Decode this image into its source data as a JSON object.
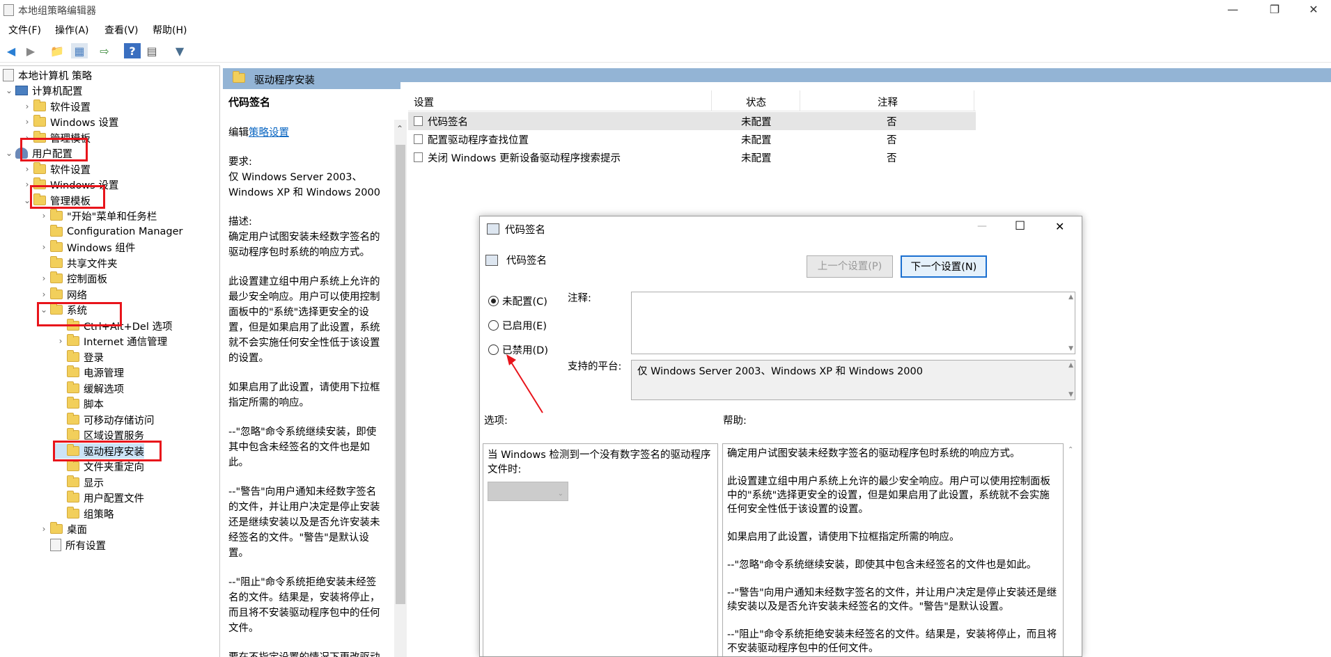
{
  "window": {
    "title": "本地组策略编辑器"
  },
  "menu": [
    "文件(F)",
    "操作(A)",
    "查看(V)",
    "帮助(H)"
  ],
  "tree": {
    "root": "本地计算机 策略",
    "computer_config": "计算机配置",
    "cc_software": "软件设置",
    "cc_windows": "Windows 设置",
    "cc_admin": "管理模板",
    "user_config": "用户配置",
    "uc_software": "软件设置",
    "uc_windows": "Windows 设置",
    "uc_admin": "管理模板",
    "start_menu": "\"开始\"菜单和任务栏",
    "config_manager": "Configuration Manager",
    "windows_components": "Windows 组件",
    "shared_folders": "共享文件夹",
    "control_panel": "控制面板",
    "network": "网络",
    "system": "系统",
    "cad": "Ctrl+Alt+Del 选项",
    "internet_comm": "Internet 通信管理",
    "logon": "登录",
    "power": "电源管理",
    "mitigation": "缓解选项",
    "scripts": "脚本",
    "removable": "可移动存储访问",
    "locale": "区域设置服务",
    "driver_install": "驱动程序安装",
    "folder_redirect": "文件夹重定向",
    "display": "显示",
    "user_profiles": "用户配置文件",
    "group_policy": "组策略",
    "desktop": "桌面",
    "all_settings": "所有设置"
  },
  "right": {
    "header": "驱动程序安装",
    "desc_title": "代码签名",
    "edit_prefix": "编辑",
    "edit_link": "策略设置",
    "requirements_label": "要求:",
    "requirements": "仅 Windows Server 2003、Windows XP 和 Windows 2000",
    "description_label": "描述:",
    "p1": "确定用户试图安装未经数字签名的驱动程序包时系统的响应方式。",
    "p2": "此设置建立组中用户系统上允许的最少安全响应。用户可以使用控制面板中的\"系统\"选择更安全的设置，但是如果启用了此设置，系统就不会实施任何安全性低于该设置的设置。",
    "p3": "如果启用了此设置，请使用下拉框指定所需的响应。",
    "p4": "--\"忽略\"命令系统继续安装，即使其中包含未经签名的文件也是如此。",
    "p5": "--\"警告\"向用户通知未经数字签名的文件，并让用户决定是停止安装还是继续安装以及是否允许安装未经签名的文件。\"警告\"是默认设置。",
    "p6": "--\"阻止\"命令系统拒绝安装未经签名的文件。结果是，安装将停止，而且将不安装驱动程序包中的任何文件。",
    "p7": "要在不指定设置的情况下更改驱动"
  },
  "list": {
    "col_setting": "设置",
    "col_state": "状态",
    "col_comment": "注释",
    "rows": [
      {
        "name": "代码签名",
        "state": "未配置",
        "comment": "否"
      },
      {
        "name": "配置驱动程序查找位置",
        "state": "未配置",
        "comment": "否"
      },
      {
        "name": "关闭 Windows 更新设备驱动程序搜索提示",
        "state": "未配置",
        "comment": "否"
      }
    ]
  },
  "dialog": {
    "title": "代码签名",
    "subtitle": "代码签名",
    "prev_btn": "上一个设置(P)",
    "next_btn": "下一个设置(N)",
    "opt_not_configured": "未配置(C)",
    "opt_enabled": "已启用(E)",
    "opt_disabled": "已禁用(D)",
    "comment_label": "注释:",
    "platform_label": "支持的平台:",
    "platform_value": "仅 Windows Server 2003、Windows XP 和 Windows 2000",
    "options_label": "选项:",
    "help_label": "帮助:",
    "options_text": "当 Windows 检测到一个没有数字签名的驱动程序文件时:",
    "help_p1": "确定用户试图安装未经数字签名的驱动程序包时系统的响应方式。",
    "help_p2": "此设置建立组中用户系统上允许的最少安全响应。用户可以使用控制面板中的\"系统\"选择更安全的设置，但是如果启用了此设置，系统就不会实施任何安全性低于该设置的设置。",
    "help_p3": "如果启用了此设置，请使用下拉框指定所需的响应。",
    "help_p4": "--\"忽略\"命令系统继续安装，即使其中包含未经签名的文件也是如此。",
    "help_p5": "--\"警告\"向用户通知未经数字签名的文件，并让用户决定是停止安装还是继续安装以及是否允许安装未经签名的文件。\"警告\"是默认设置。",
    "help_p6": "--\"阻止\"命令系统拒绝安装未经签名的文件。结果是，安装将停止，而且将不安装驱动程序包中的任何文件。"
  },
  "colors": {
    "annotation_red": "#e8141b",
    "header_blue": "#93b4d5",
    "link": "#0563c1"
  }
}
